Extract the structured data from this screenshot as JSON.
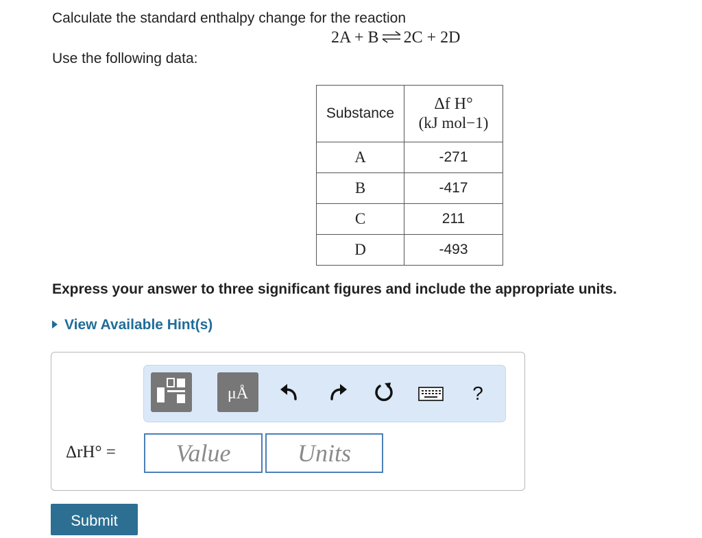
{
  "question": {
    "prompt": "Calculate the standard enthalpy change for the reaction",
    "reaction": {
      "left": "2A + B",
      "right": "2C + 2D"
    },
    "use_data": "Use the following data:"
  },
  "table": {
    "header_substance": "Substance",
    "header_dh": "Δf H°",
    "header_unit": "(kJ mol−1)",
    "rows": [
      {
        "substance": "A",
        "value": "-271"
      },
      {
        "substance": "B",
        "value": "-417"
      },
      {
        "substance": "C",
        "value": "211"
      },
      {
        "substance": "D",
        "value": "-493"
      }
    ]
  },
  "instructions": "Express your answer to three significant figures and include the appropriate units.",
  "hint_link": "View Available Hint(s)",
  "toolbar": {
    "units_label": "μÅ",
    "help_label": "?",
    "colors": {
      "bar": "#dbe8f8",
      "button": "#777777",
      "icon": "#111111"
    },
    "icons": [
      "templates-icon",
      "units-icon",
      "undo-icon",
      "redo-icon",
      "reset-icon",
      "keyboard-icon",
      "help-icon"
    ]
  },
  "answer": {
    "label": "ΔrH° =",
    "value_placeholder": "Value",
    "units_placeholder": "Units"
  },
  "submit_label": "Submit",
  "colors": {
    "link": "#1f6d98",
    "submit": "#2c6f93",
    "field_border": "#4a7fb6"
  }
}
